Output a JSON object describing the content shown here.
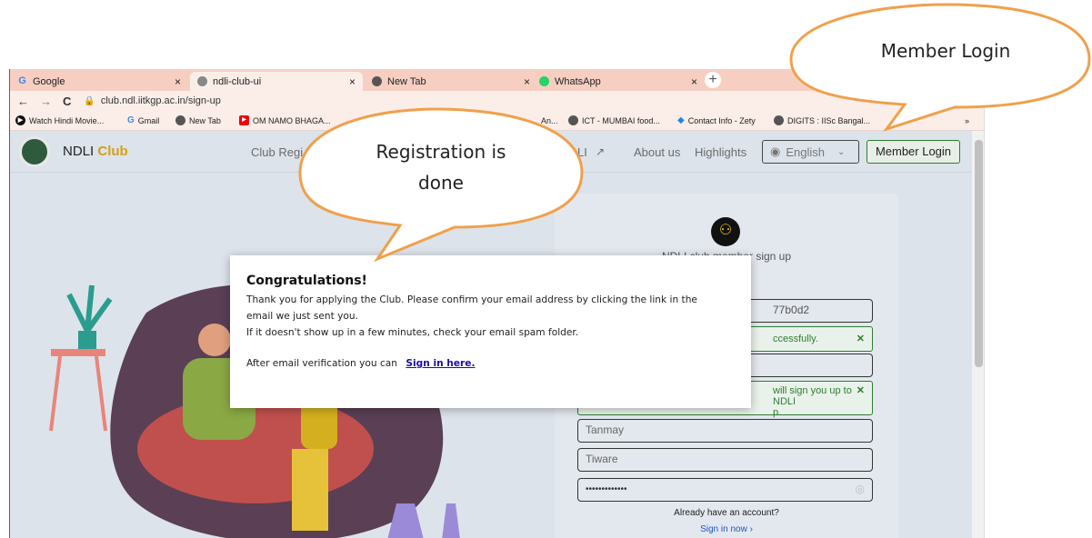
{
  "browser": {
    "tabs": [
      {
        "title": "Google",
        "icon": "google-icon"
      },
      {
        "title": "ndli-club-ui",
        "icon": "site-icon"
      },
      {
        "title": "New Tab",
        "icon": "chrome-icon"
      },
      {
        "title": "WhatsApp",
        "icon": "whatsapp-icon"
      }
    ],
    "close_glyph": "×",
    "newtab_glyph": "+",
    "url": "club.ndl.iitkgp.ac.in/sign-up",
    "bookmarks": [
      "Watch Hindi Movie...",
      "Gmail",
      "New Tab",
      "OM NAMO BHAGA...",
      "An...",
      "ICT - MUMBAI food...",
      "Contact Info - Zety",
      "DIGITS : IISc Bangal..."
    ],
    "bookmarks_more": "»"
  },
  "site": {
    "logo_prefix": "NDLI",
    "logo_suffix": "Club",
    "nav": [
      "Club Regi",
      "LI",
      "About us",
      "Highlights"
    ],
    "language": "English",
    "login_button": "Member Login"
  },
  "signup": {
    "title": "NDLI club member sign up",
    "field1_value": "77b0d2",
    "success1": "ccessfully.",
    "success2_line1": "will sign you up to NDLI",
    "success2_line2": "p",
    "first_name": "Tanmay",
    "last_name": "Tiware",
    "password_mask": "•••••••••••••",
    "already": "Already have an account?",
    "signin_link": "Sign in now ›"
  },
  "modal": {
    "title": "Congratulations!",
    "line1": "Thank you for applying the Club. Please confirm your email address by clicking the link in the",
    "line2": "email we just sent you.",
    "line3": "If it doesn't show up in a few minutes, check your email spam folder.",
    "line4_prefix": "After email verification you can",
    "line4_link": "Sign in here."
  },
  "annotations": {
    "bubble1_line1": "Registration is",
    "bubble1_line2": "done",
    "bubble2": "Member Login",
    "color": "#f0a04b"
  }
}
